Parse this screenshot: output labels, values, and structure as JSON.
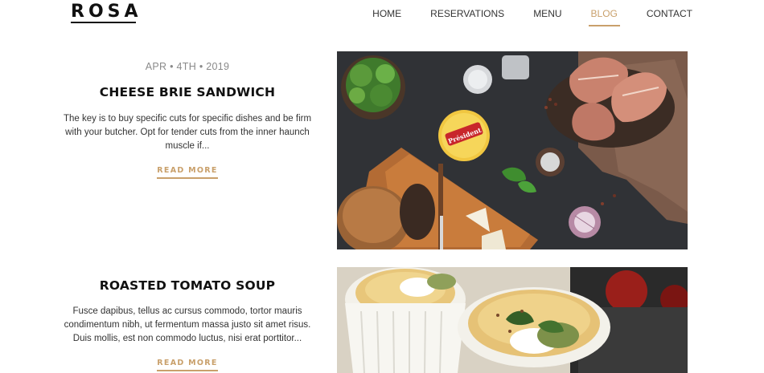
{
  "brand": {
    "logo_text": "ROSA"
  },
  "nav": {
    "items": [
      {
        "label": "HOME",
        "active": false
      },
      {
        "label": "RESERVATIONS",
        "active": false
      },
      {
        "label": "MENU",
        "active": false
      },
      {
        "label": "BLOG",
        "active": true
      },
      {
        "label": "CONTACT",
        "active": false
      }
    ]
  },
  "colors": {
    "accent": "#c9a06b",
    "text": "#222222",
    "muted": "#8a8a8a"
  },
  "posts": [
    {
      "date": "APR • 4TH • 2019",
      "title": "CHEESE BRIE SANDWICH",
      "excerpt": "The key is to buy specific cuts for specific dishes and be firm with your butcher. Opt for tender cuts from the inner haunch muscle if...",
      "read_more": "READ MORE",
      "image_label": "Président"
    },
    {
      "date": "",
      "title": "ROASTED TOMATO SOUP",
      "excerpt": "Fusce dapibus, tellus ac cursus commodo, tortor mauris condimentum nibh, ut fermentum massa justo sit amet risus. Duis mollis, est non commodo luctus, nisi erat porttitor...",
      "read_more": "READ MORE"
    }
  ]
}
